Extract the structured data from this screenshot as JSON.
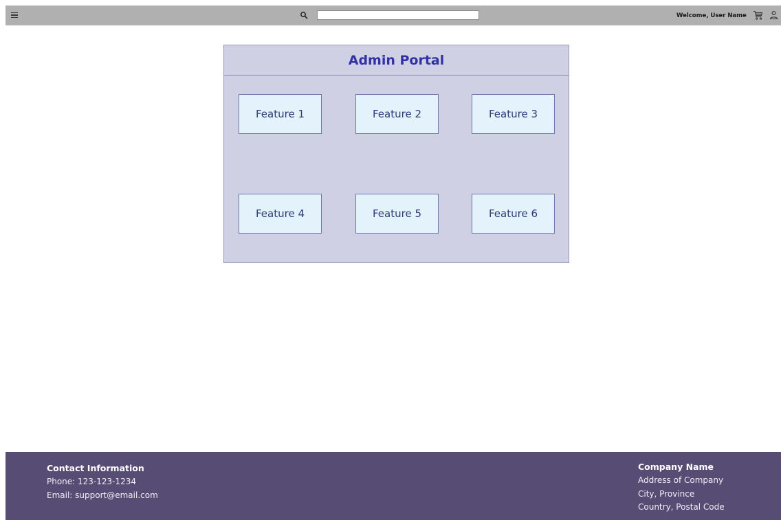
{
  "header": {
    "menu_icon": "hamburger-menu-icon",
    "search_icon": "search-icon",
    "search": {
      "value": "",
      "placeholder": ""
    },
    "welcome_text": "Welcome, User Name",
    "cart_icon": "shopping-cart-icon",
    "user_icon": "user-account-icon"
  },
  "portal": {
    "title": "Admin Portal",
    "features": [
      {
        "label": "Feature 1"
      },
      {
        "label": "Feature 2"
      },
      {
        "label": "Feature 3"
      },
      {
        "label": "Feature 4"
      },
      {
        "label": "Feature 5"
      },
      {
        "label": "Feature 6"
      }
    ]
  },
  "footer": {
    "contact": {
      "heading": "Contact Information",
      "phone": "Phone: 123-123-1234",
      "email": "Email: support@email.com"
    },
    "company": {
      "name": "Company Name",
      "address": "Address of Company",
      "city": "City, Province",
      "country": "Country, Postal Code"
    }
  },
  "colors": {
    "topbar": "#b0b0b0",
    "portal_bg": "#cfd0e3",
    "portal_title": "#3232a6",
    "feature_bg": "#e3f2fb",
    "footer_bg": "#574c74"
  }
}
